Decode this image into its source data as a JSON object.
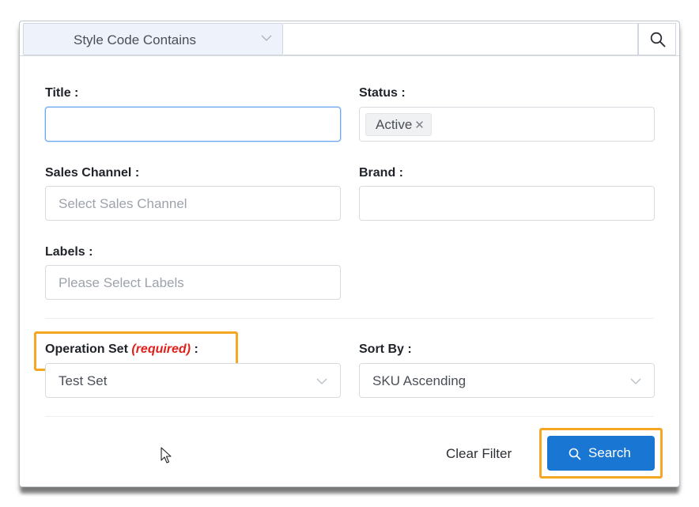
{
  "topbar": {
    "filter_select_label": "Style Code Contains",
    "search_value": ""
  },
  "fields": {
    "title": {
      "label": "Title :",
      "value": ""
    },
    "status": {
      "label": "Status :",
      "tags": [
        "Active"
      ]
    },
    "sales_channel": {
      "label": "Sales Channel :",
      "placeholder": "Select Sales Channel"
    },
    "brand": {
      "label": "Brand :",
      "value": ""
    },
    "labels": {
      "label": "Labels :",
      "placeholder": "Please Select Labels"
    },
    "operation_set": {
      "label": "Operation Set",
      "required_text": "(required)",
      "label_suffix": " :",
      "value": "Test Set"
    },
    "sort_by": {
      "label": "Sort By :",
      "value": "SKU Ascending"
    }
  },
  "actions": {
    "clear_label": "Clear Filter",
    "search_label": "Search"
  },
  "colors": {
    "primary": "#1976d2",
    "highlight": "#f5a623",
    "required": "#e0201b",
    "focus": "#6ea6f0"
  },
  "icons": {
    "search": "search-icon",
    "chevron": "chevron-down-icon",
    "remove_tag": "close-icon",
    "cursor": "mouse-pointer-icon"
  }
}
